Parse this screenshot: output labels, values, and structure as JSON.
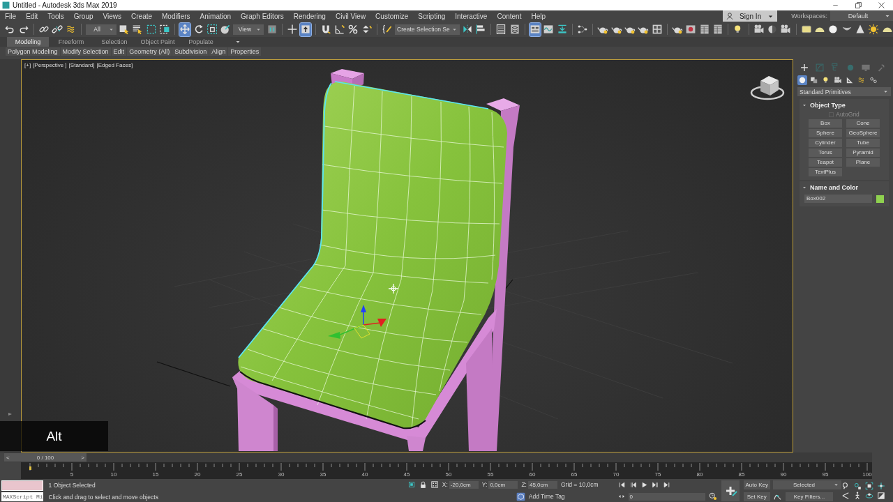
{
  "window": {
    "title": "Untitled - Autodesk 3ds Max 2019"
  },
  "menu": [
    "File",
    "Edit",
    "Tools",
    "Group",
    "Views",
    "Create",
    "Modifiers",
    "Animation",
    "Graph Editors",
    "Rendering",
    "Civil View",
    "Customize",
    "Scripting",
    "Interactive",
    "Content",
    "Help"
  ],
  "account": {
    "label": "Sign In"
  },
  "workspaces": {
    "label": "Workspaces:",
    "value": "Default"
  },
  "toolbar": [
    {
      "kind": "undo",
      "selected": false
    },
    {
      "kind": "redo",
      "selected": false
    },
    {
      "kind": "separator"
    },
    {
      "kind": "link",
      "selected": false
    },
    {
      "kind": "unlink",
      "selected": false
    },
    {
      "kind": "wave",
      "selected": false
    },
    {
      "kind": "separator"
    },
    {
      "kind": "dropdown",
      "value": "All"
    },
    {
      "kind": "select",
      "selected": false
    },
    {
      "kind": "list-select",
      "selected": false
    },
    {
      "kind": "rect-select",
      "selected": false
    },
    {
      "kind": "crossing",
      "selected": false
    },
    {
      "kind": "separator"
    },
    {
      "kind": "move",
      "selected": true
    },
    {
      "kind": "rotate",
      "selected": false
    },
    {
      "kind": "scale",
      "selected": false
    },
    {
      "kind": "placement",
      "selected": false
    },
    {
      "kind": "dropdown",
      "value": "View"
    },
    {
      "kind": "pivot",
      "selected": false
    },
    {
      "kind": "separator"
    },
    {
      "kind": "crosshair",
      "selected": false
    },
    {
      "kind": "up-box",
      "selected": true
    },
    {
      "kind": "separator"
    },
    {
      "kind": "magnet",
      "selected": false
    },
    {
      "kind": "angle",
      "selected": false
    },
    {
      "kind": "percent",
      "selected": false
    },
    {
      "kind": "spinner",
      "selected": false
    },
    {
      "kind": "separator"
    },
    {
      "kind": "pencil",
      "selected": false
    },
    {
      "kind": "dropdown",
      "value": "Create Selection Se"
    },
    {
      "kind": "mirror",
      "selected": false
    },
    {
      "kind": "align",
      "selected": false
    },
    {
      "kind": "separator"
    },
    {
      "kind": "list",
      "selected": false
    },
    {
      "kind": "layers",
      "selected": false
    },
    {
      "kind": "separator"
    },
    {
      "kind": "ribbon",
      "selected": true
    },
    {
      "kind": "curve",
      "selected": false
    },
    {
      "kind": "dock",
      "selected": false
    },
    {
      "kind": "separator"
    },
    {
      "kind": "nodes",
      "selected": false
    },
    {
      "kind": "separator"
    },
    {
      "kind": "teapot",
      "selected": false
    },
    {
      "kind": "teapot",
      "selected": false
    },
    {
      "kind": "teapot",
      "selected": false
    },
    {
      "kind": "teapot",
      "selected": false
    },
    {
      "kind": "grid4",
      "selected": false
    },
    {
      "kind": "separator"
    },
    {
      "kind": "teapot",
      "selected": false
    },
    {
      "kind": "frame",
      "selected": false
    },
    {
      "kind": "table",
      "selected": false
    },
    {
      "kind": "table",
      "selected": false
    },
    {
      "kind": "separator"
    },
    {
      "kind": "bulb",
      "selected": false
    },
    {
      "kind": "separator"
    },
    {
      "kind": "camera",
      "selected": false
    },
    {
      "kind": "half-sphere",
      "selected": false
    },
    {
      "kind": "camera",
      "selected": false
    },
    {
      "kind": "separator"
    },
    {
      "kind": "rounded-box",
      "selected": false
    },
    {
      "kind": "dome",
      "selected": false
    },
    {
      "kind": "sphere",
      "selected": false
    },
    {
      "kind": "shell",
      "selected": false
    },
    {
      "kind": "cone",
      "selected": false
    },
    {
      "kind": "sun",
      "selected": false
    },
    {
      "kind": "dome",
      "selected": false
    }
  ],
  "ribbon": {
    "tabs": [
      {
        "label": "Modeling",
        "selected": true
      },
      {
        "label": "Freeform",
        "selected": false
      },
      {
        "label": "Selection",
        "selected": false
      },
      {
        "label": "Object Paint",
        "selected": false
      },
      {
        "label": "Populate",
        "selected": false
      }
    ],
    "panels": [
      "Polygon Modeling",
      "Modify Selection",
      "Edit",
      "Geometry (All)",
      "Subdivision",
      "Align",
      "Properties"
    ]
  },
  "viewport": {
    "labels": [
      "[+]",
      "[Perspective ]",
      "[Standard]",
      "[Edged Faces]"
    ]
  },
  "key_overlay": "Alt",
  "command_panel": {
    "tabs": [
      {
        "kind": "plus",
        "selected": true
      },
      {
        "kind": "modify",
        "selected": false
      },
      {
        "kind": "hierarchy",
        "selected": false
      },
      {
        "kind": "motion",
        "selected": false
      },
      {
        "kind": "monitor",
        "selected": false
      },
      {
        "kind": "wrench",
        "selected": false
      }
    ],
    "categories": [
      {
        "kind": "sphere",
        "selected": true
      },
      {
        "kind": "shapes",
        "selected": false
      },
      {
        "kind": "bulb",
        "selected": false
      },
      {
        "kind": "camera",
        "selected": false
      },
      {
        "kind": "helper",
        "selected": false
      },
      {
        "kind": "wave",
        "selected": false
      },
      {
        "kind": "systems",
        "selected": false
      }
    ],
    "category_dropdown": "Standard Primitives",
    "rollouts": [
      {
        "kind": "object_type",
        "title": "Object Type",
        "expanded": true,
        "autogrid": {
          "label": "AutoGrid",
          "checked": false,
          "disabled": true
        },
        "buttons": [
          "Box",
          "Cone",
          "Sphere",
          "GeoSphere",
          "Cylinder",
          "Tube",
          "Torus",
          "Pyramid",
          "Teapot",
          "Plane",
          "TextPlus"
        ]
      },
      {
        "kind": "name_color",
        "title": "Name and Color",
        "expanded": true,
        "name": "Box002",
        "color": "#8fd14f"
      }
    ]
  },
  "time_slider": {
    "prev": "<",
    "reading": "0 / 100",
    "next": ">",
    "level": 0
  },
  "timeline": {
    "labels": [
      "5",
      "10",
      "15",
      "20",
      "25",
      "30",
      "35",
      "40",
      "45",
      "50",
      "55",
      "60",
      "65",
      "70",
      "75",
      "80",
      "85",
      "90",
      "95",
      "100"
    ]
  },
  "status": {
    "maxscript": "MAXScript Mi",
    "prompt": "1 Object Selected",
    "hint": "Click and drag to select and move objects",
    "coords": [
      {
        "axis": "X:",
        "value": "-20,0cm"
      },
      {
        "axis": "Y:",
        "value": "0,0cm"
      },
      {
        "axis": "Z:",
        "value": "45,0cm"
      }
    ],
    "grid": "Grid = 10,0cm",
    "time_tag": "Add Time Tag",
    "frame": "0",
    "auto_key": {
      "label": "Auto Key",
      "on": false
    },
    "set_key": "Set Key",
    "key_set": "Selected",
    "key_filters": "Key Filters..."
  }
}
